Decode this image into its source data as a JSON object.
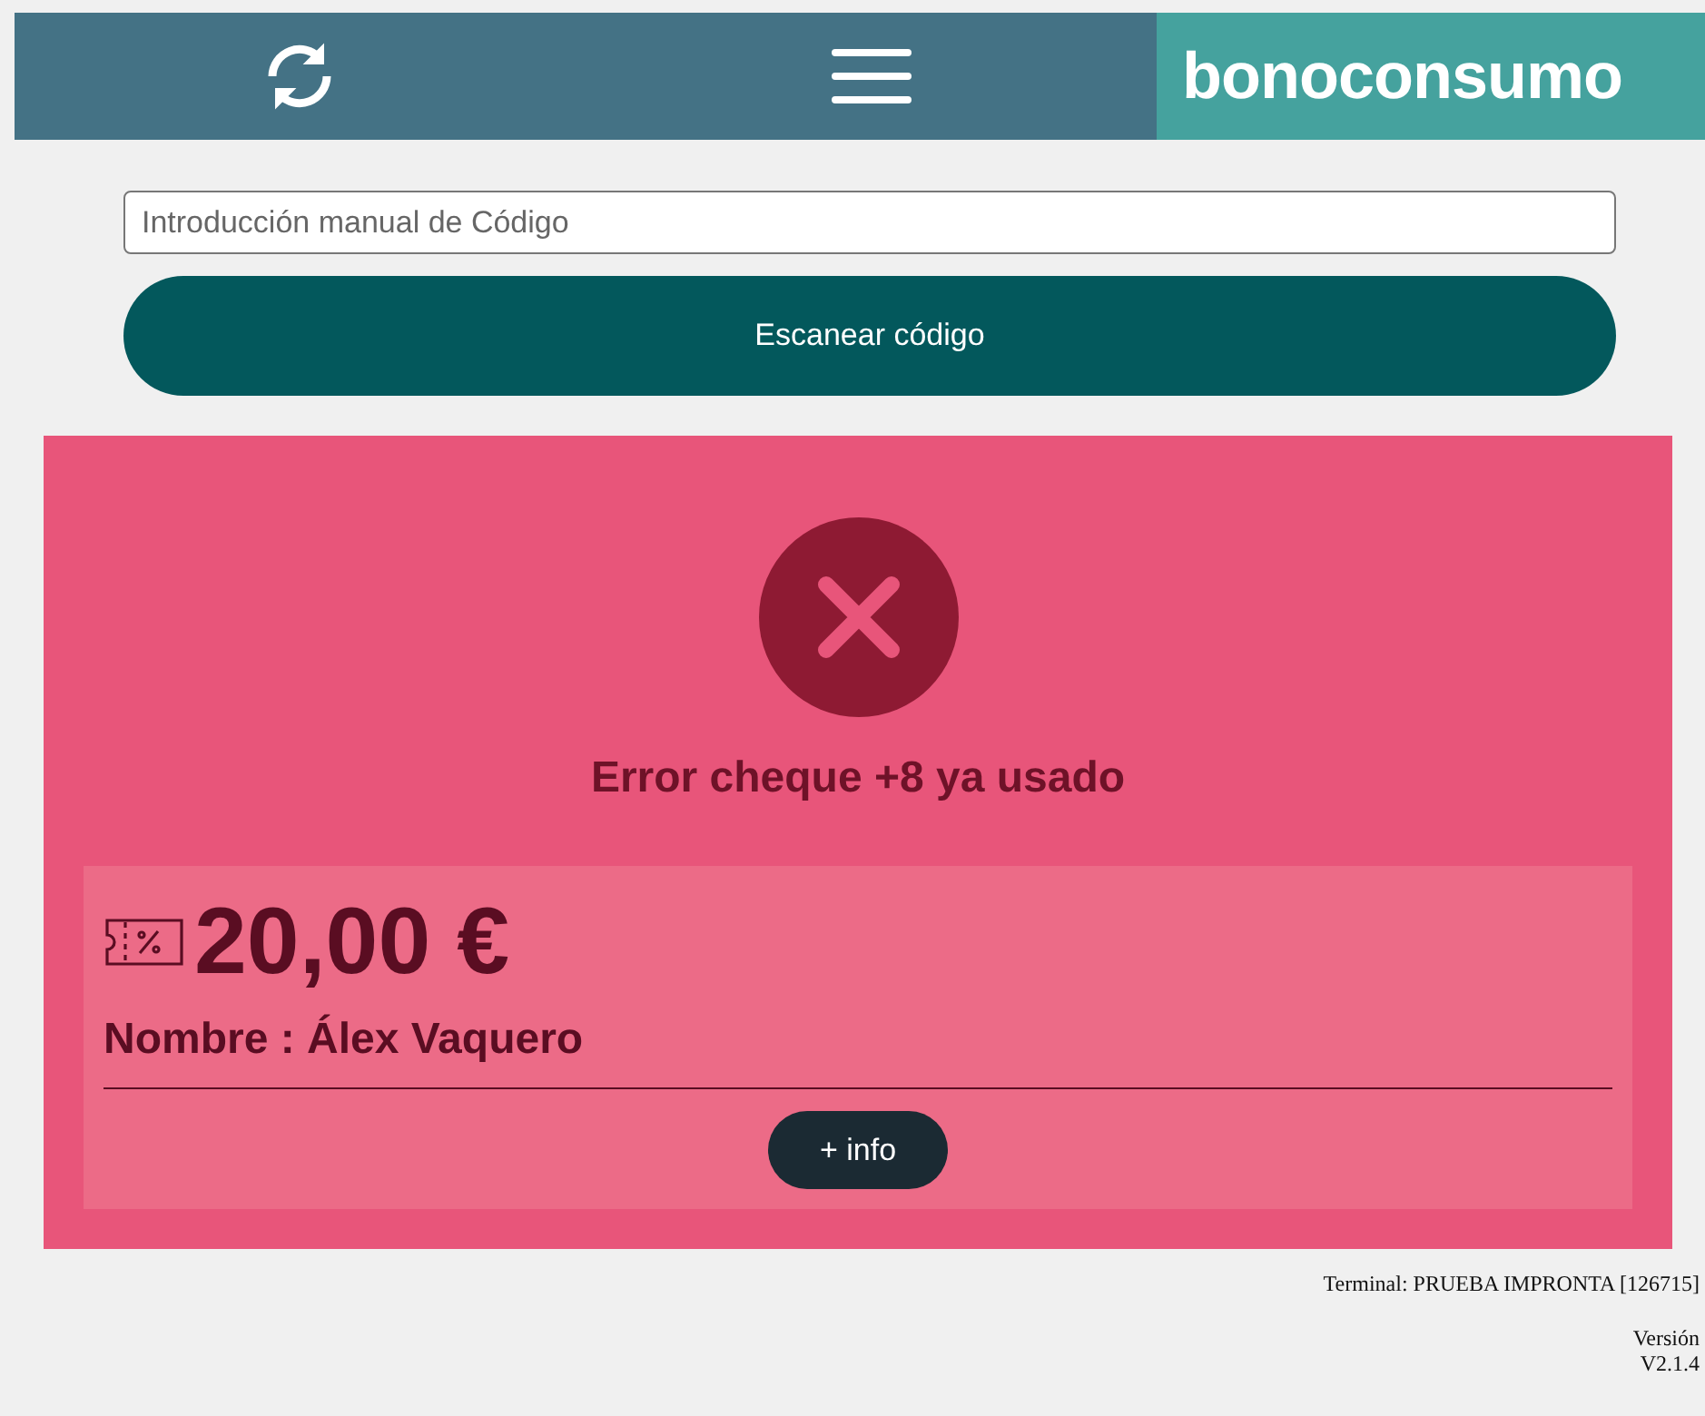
{
  "header": {
    "logo": "bonoconsumo"
  },
  "code_input": {
    "placeholder": "Introducción manual de Código"
  },
  "scan_button": "Escanear código",
  "result": {
    "failed": true,
    "message": "Error cheque +8 ya usado",
    "amount": "20,00 €",
    "name": "Nombre : Álex Vaquero",
    "info_button": "+ info"
  },
  "footer": {
    "terminal": "Terminal: PRUEBA IMPRONTA [126715]",
    "version_label": "Versión",
    "version": "V2.1.4"
  }
}
